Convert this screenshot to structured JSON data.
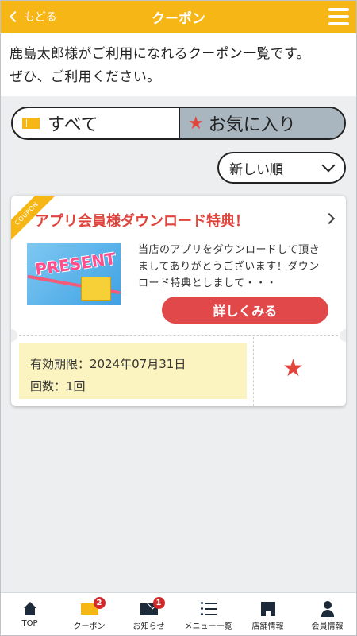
{
  "header": {
    "back_label": "もどる",
    "title": "クーポン"
  },
  "intro": {
    "line1": "鹿島太郎様がご利用になれるクーポン一覧です。",
    "line2": "ぜひ、ご利用ください。"
  },
  "filter": {
    "all_label": "すべて",
    "favorites_label": "お気に入り",
    "selected": "all"
  },
  "sort": {
    "selected_label": "新しい順"
  },
  "coupon": {
    "ribbon_label": "COUPON",
    "title": "アプリ会員様ダウンロード特典！",
    "image_label": "PRESENT",
    "description": "当店のアプリをダウンロードして頂きましてありがとうございます！ダウンロード特典としまして・・・",
    "detail_button": "詳しくみる",
    "expiry_line": "有効期限：2024年07月31日",
    "count_line": "回数：1回"
  },
  "tabs": [
    {
      "label": "TOP",
      "icon": "home-icon"
    },
    {
      "label": "クーポン",
      "icon": "coupon-icon",
      "badge": "2"
    },
    {
      "label": "お知らせ",
      "icon": "mail-icon",
      "badge": "1"
    },
    {
      "label": "メニュー一覧",
      "icon": "menu-list-icon"
    },
    {
      "label": "店舗情報",
      "icon": "shop-icon"
    },
    {
      "label": "会員情報",
      "icon": "user-icon"
    }
  ],
  "colors": {
    "accent": "#f5b616",
    "red": "#e0443c",
    "fav_bg": "#a9b6c0",
    "expiry_bg": "#fbf3c0"
  }
}
